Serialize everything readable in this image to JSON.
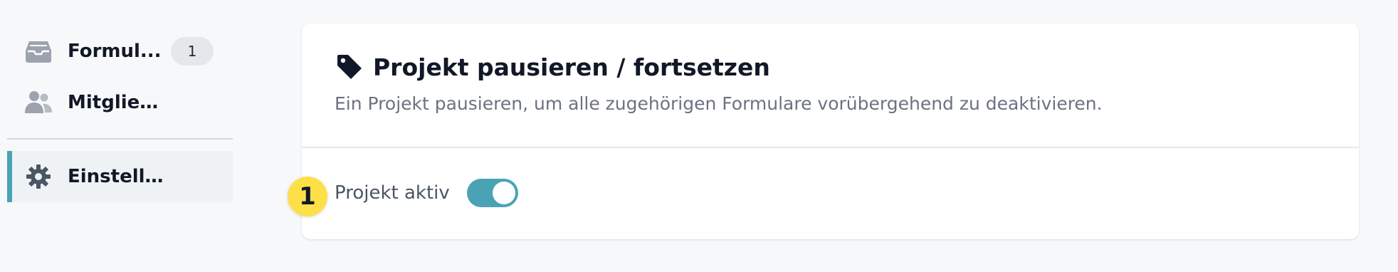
{
  "sidebar": {
    "items": [
      {
        "label": "Formul...",
        "icon": "inbox-icon",
        "badge": "1"
      },
      {
        "label": "Mitglieder",
        "icon": "users-icon"
      },
      {
        "label": "Einstellungen",
        "icon": "gear-icon",
        "active": true
      }
    ]
  },
  "card": {
    "icon": "tag-icon",
    "title": "Projekt pausieren / fortsetzen",
    "description": "Ein Projekt pausieren, um alle zugehörigen Formulare vorübergehend zu deaktivieren.",
    "step_number": "1",
    "toggle_label": "Projekt aktiv",
    "toggle_on": true
  },
  "colors": {
    "accent": "#4aa3b4",
    "step_badge": "#fde047",
    "background": "#f7f8fa"
  }
}
